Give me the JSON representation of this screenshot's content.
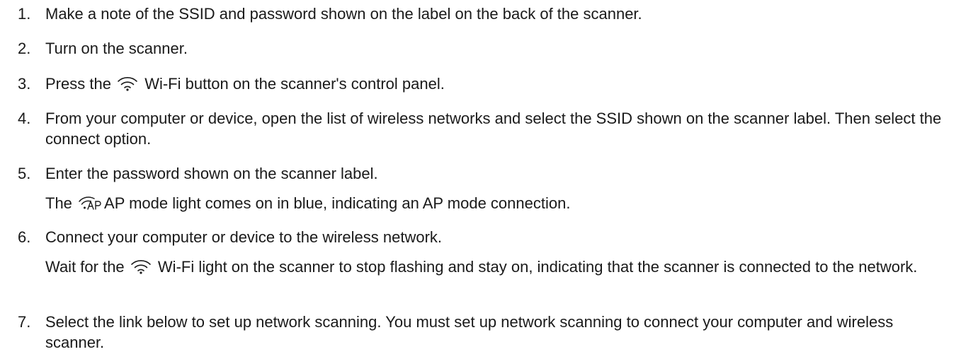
{
  "steps": [
    {
      "number": "1.",
      "text": "Make a note of the SSID and password shown on the label on the back of the scanner."
    },
    {
      "number": "2.",
      "text": "Turn on the scanner."
    },
    {
      "number": "3.",
      "before": "Press the",
      "icon": "wifi-icon",
      "after": "Wi-Fi button on the scanner's control panel."
    },
    {
      "number": "4.",
      "text": "From your computer or device, open the list of wireless networks and select the SSID shown on the scanner label. Then select the connect option."
    },
    {
      "number": "5.",
      "text": "Enter the password shown on the scanner label.",
      "note": {
        "before": "The",
        "icon": "ap-mode-icon",
        "after": "AP mode light comes on in blue, indicating an AP mode connection."
      }
    },
    {
      "number": "6.",
      "text": "Connect your computer or device to the wireless network.",
      "note": {
        "before": "Wait for the",
        "icon": "wifi-icon",
        "after": "Wi-Fi light on the scanner to stop flashing and stay on, indicating that the scanner is connected to the network."
      }
    },
    {
      "number": "7.",
      "text": "Select the link below to set up network scanning. You must set up network scanning to connect your computer and wireless scanner."
    }
  ]
}
